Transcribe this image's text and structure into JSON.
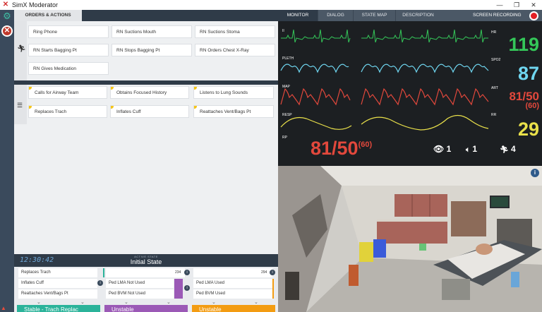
{
  "app": {
    "title": "SimX Moderator",
    "window_controls": [
      "—",
      "❐",
      "✕"
    ]
  },
  "left_panel": {
    "tab_label": "ORDERS & ACTIONS",
    "orders": [
      "Ring Phone",
      "RN Suctions Mouth",
      "RN Suctions Stoma",
      "RN Starts Bagging Pt",
      "RN Stops Bagging Pt",
      "RN Orders Chest X-Ray",
      "RN Gives Medication"
    ],
    "actions": [
      "Calls for Airway Team",
      "Obtains Focused History",
      "Listens to Lung Sounds",
      "Replaces Trach",
      "Inflates Cuff",
      "Reattaches Vent/Bags Pt"
    ]
  },
  "state_bar": {
    "time": "12:30:42",
    "label": "ACTIVE STATE",
    "name": "Initial State"
  },
  "bottom_states": [
    {
      "items": [
        "Replaces Trach",
        "Inflates Cuff",
        "Reattaches Vent/Bags Pt"
      ],
      "number": "",
      "state": "Stable - Trach Replac",
      "color": "#2bb39a"
    },
    {
      "items": [
        "",
        "Ped LMA Not Used",
        "Ped BVM Not Used"
      ],
      "number": "234",
      "state": "Unstable",
      "color": "#9b59b6"
    },
    {
      "items": [
        "",
        "Ped LMA Used",
        "Ped BVM Used"
      ],
      "number": "294",
      "state": "Unstable",
      "color": "#f39c12"
    }
  ],
  "right_tabs": {
    "tabs": [
      "MONITOR",
      "DIALOG",
      "STATE MAP",
      "DESCRIPTION"
    ],
    "recording_label": "SCREEN RECORDING"
  },
  "monitor": {
    "channels": [
      {
        "label": "II",
        "color": "#34c759"
      },
      {
        "label": "PLETH",
        "color": "#6fd6f0"
      },
      {
        "label": "MAP",
        "color": "#e2483c"
      },
      {
        "label": "RESP",
        "color": "#e9e04a"
      }
    ],
    "rp_label": "RP",
    "vitals": [
      {
        "label": "HR",
        "value": "119",
        "color": "#34c759"
      },
      {
        "label": "SPO2",
        "value": "87",
        "color": "#6fd6f0"
      },
      {
        "label": "ART",
        "value": "81/50",
        "sub": "(60)",
        "color": "#e2483c"
      },
      {
        "label": "RR",
        "value": "29",
        "color": "#e9e04a"
      }
    ],
    "bp_main": "81/50",
    "bp_sub": "(60)",
    "counts": [
      {
        "icon": "eye-icon",
        "value": "1"
      },
      {
        "icon": "speaker-icon",
        "value": "1"
      },
      {
        "icon": "person-walking-icon",
        "value": "4"
      }
    ]
  },
  "scene": {
    "info_label": "i"
  }
}
